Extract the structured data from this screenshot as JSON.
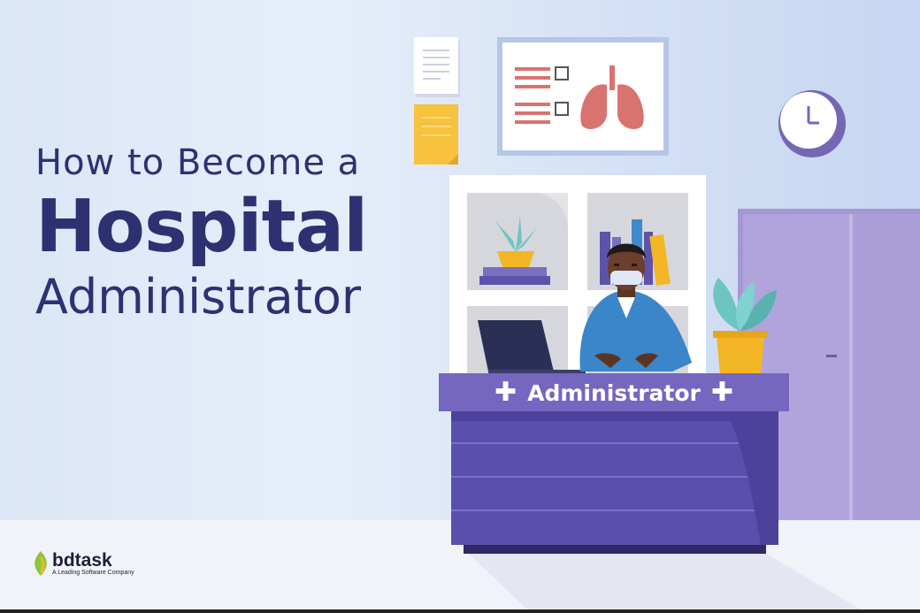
{
  "headline": {
    "line1": "How to Become a",
    "line2": "Hospital",
    "line3": "Administrator"
  },
  "desk_sign": {
    "label": "Administrator",
    "left_icon": "plus-icon",
    "right_icon": "plus-icon"
  },
  "logo": {
    "brand": "bdtask",
    "tagline": "A Leading Software Company"
  },
  "colors": {
    "title": "#2e3171",
    "desk": "#5a4fad",
    "desk_top": "#7566c0",
    "shirt": "#3b86c9",
    "lungs": "#d97370",
    "sticky_note": "#f7c23e",
    "plant": "#6cc5c2",
    "pot": "#f3b624",
    "door": "#a597d4"
  }
}
